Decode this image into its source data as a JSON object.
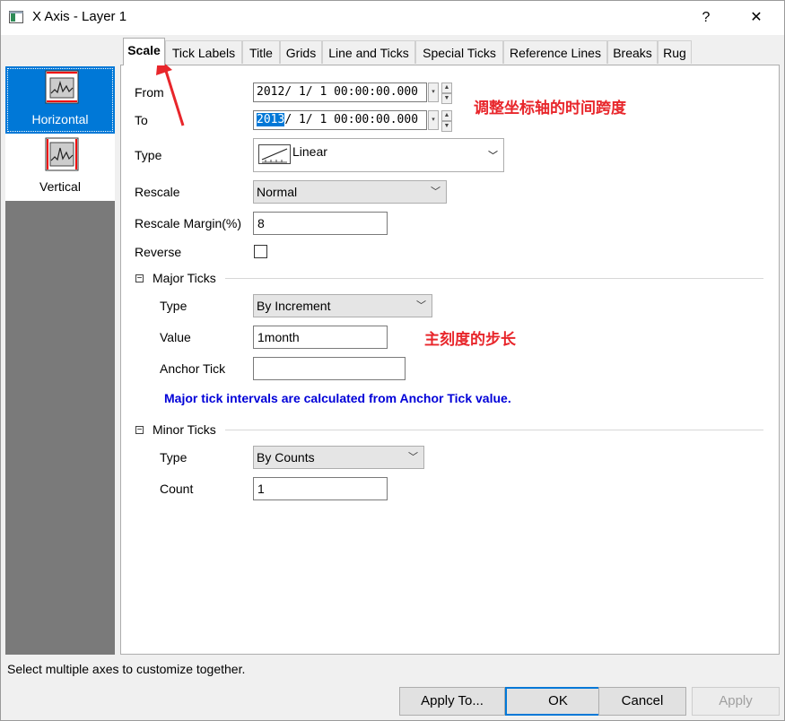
{
  "window": {
    "title": "X Axis - Layer 1",
    "help": "?",
    "close": "✕"
  },
  "sidebar": {
    "items": [
      {
        "label": "Horizontal",
        "selected": true
      },
      {
        "label": "Vertical",
        "selected": false
      }
    ]
  },
  "tabs": [
    "Scale",
    "Tick Labels",
    "Title",
    "Grids",
    "Line and Ticks",
    "Special Ticks",
    "Reference Lines",
    "Breaks",
    "Rug"
  ],
  "scale": {
    "from_label": "From",
    "from_value": "2012/ 1/ 1 00:00:00.000",
    "to_label": "To",
    "to_value_selected": "2013",
    "to_value_rest": "/ 1/ 1 00:00:00.000",
    "type_label": "Type",
    "type_value": "Linear",
    "rescale_label": "Rescale",
    "rescale_value": "Normal",
    "margin_label": "Rescale Margin(%)",
    "margin_value": "8",
    "reverse_label": "Reverse"
  },
  "major": {
    "header": "Major Ticks",
    "type_label": "Type",
    "type_value": "By Increment",
    "value_label": "Value",
    "value_value": "1month",
    "anchor_label": "Anchor Tick",
    "anchor_value": "",
    "note": "Major tick intervals are calculated from Anchor Tick value."
  },
  "minor": {
    "header": "Minor Ticks",
    "type_label": "Type",
    "type_value": "By Counts",
    "count_label": "Count",
    "count_value": "1"
  },
  "annotations": {
    "time_span": "调整坐标轴的时间跨度",
    "major_step": "主刻度的步长"
  },
  "status_text": "Select multiple axes to customize together.",
  "buttons": {
    "apply_to": "Apply To...",
    "ok": "OK",
    "cancel": "Cancel",
    "apply": "Apply"
  },
  "colors": {
    "accent": "#0078d7",
    "annotation_red": "#e8262b",
    "note_blue": "#0000d8"
  }
}
